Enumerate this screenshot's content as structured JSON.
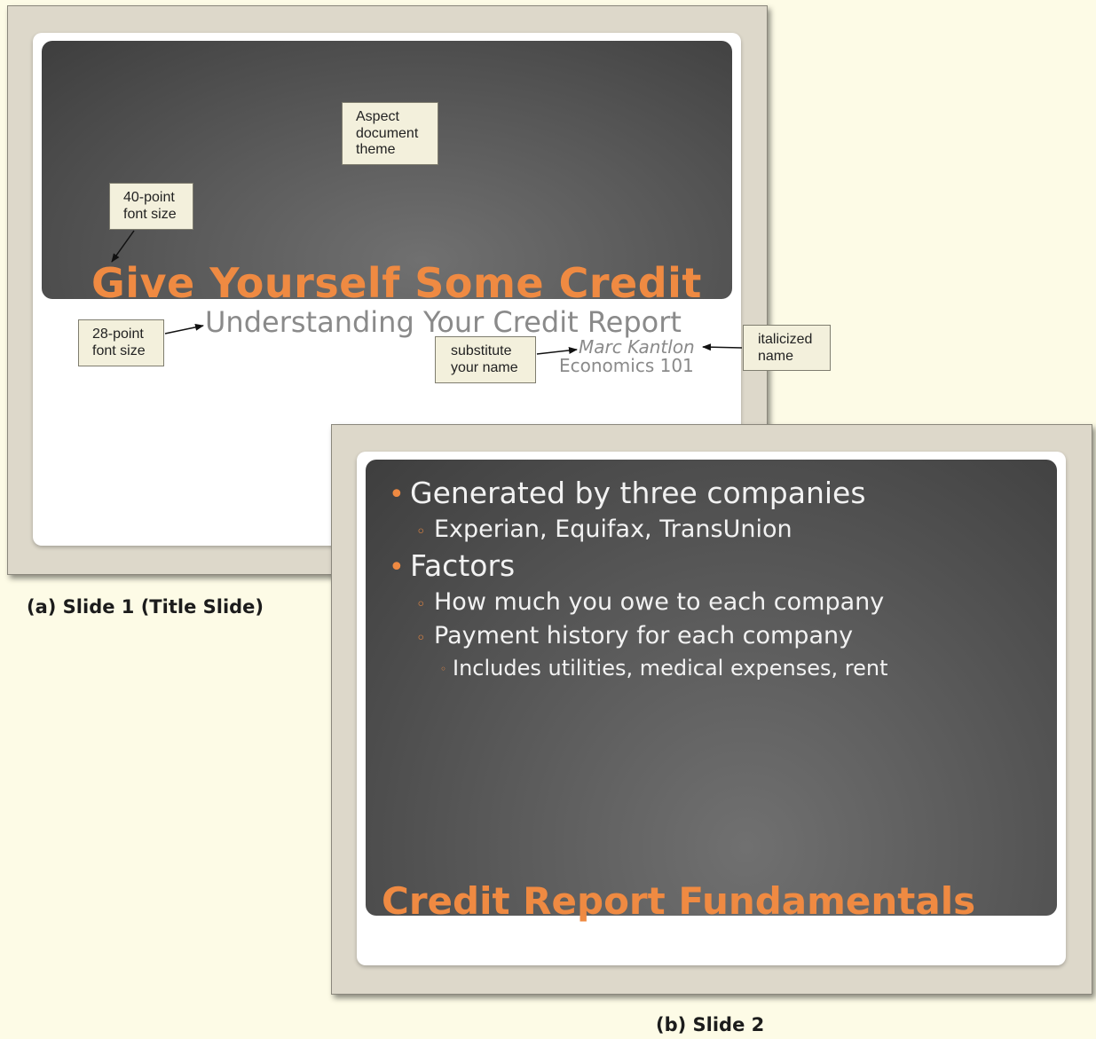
{
  "slide1": {
    "title": "Give Yourself Some Credit",
    "subtitle": "Understanding Your Credit Report",
    "author": "Marc Kantlon",
    "course": "Economics 101",
    "caption": "(a) Slide 1 (Title Slide)"
  },
  "callouts": {
    "theme": "Aspect\ndocument\ntheme",
    "font40": "40-point\nfont size",
    "font28": "28-point\nfont size",
    "substitute": "substitute\nyour name",
    "italicized": "italicized\nname"
  },
  "slide2": {
    "bullets": [
      {
        "level": 1,
        "text": "Generated by three companies"
      },
      {
        "level": 2,
        "text": "Experian, Equifax, TransUnion"
      },
      {
        "level": 1,
        "text": "Factors"
      },
      {
        "level": 2,
        "text": "How much you owe to each company"
      },
      {
        "level": 2,
        "text": "Payment history for each company"
      },
      {
        "level": 3,
        "text": "Includes utilities, medical expenses, rent"
      }
    ],
    "title": "Credit Report Fundamentals",
    "caption": "(b) Slide 2"
  },
  "colors": {
    "accent": "#ef8a42",
    "background": "#fdfbe6",
    "frame": "#ddd8ca",
    "slide_dark": "#555555"
  },
  "icons": {
    "bullet_level1": "bullet-dot-icon",
    "bullet_level2": "bullet-ring-icon",
    "bullet_level3": "bullet-small-ring-icon"
  }
}
